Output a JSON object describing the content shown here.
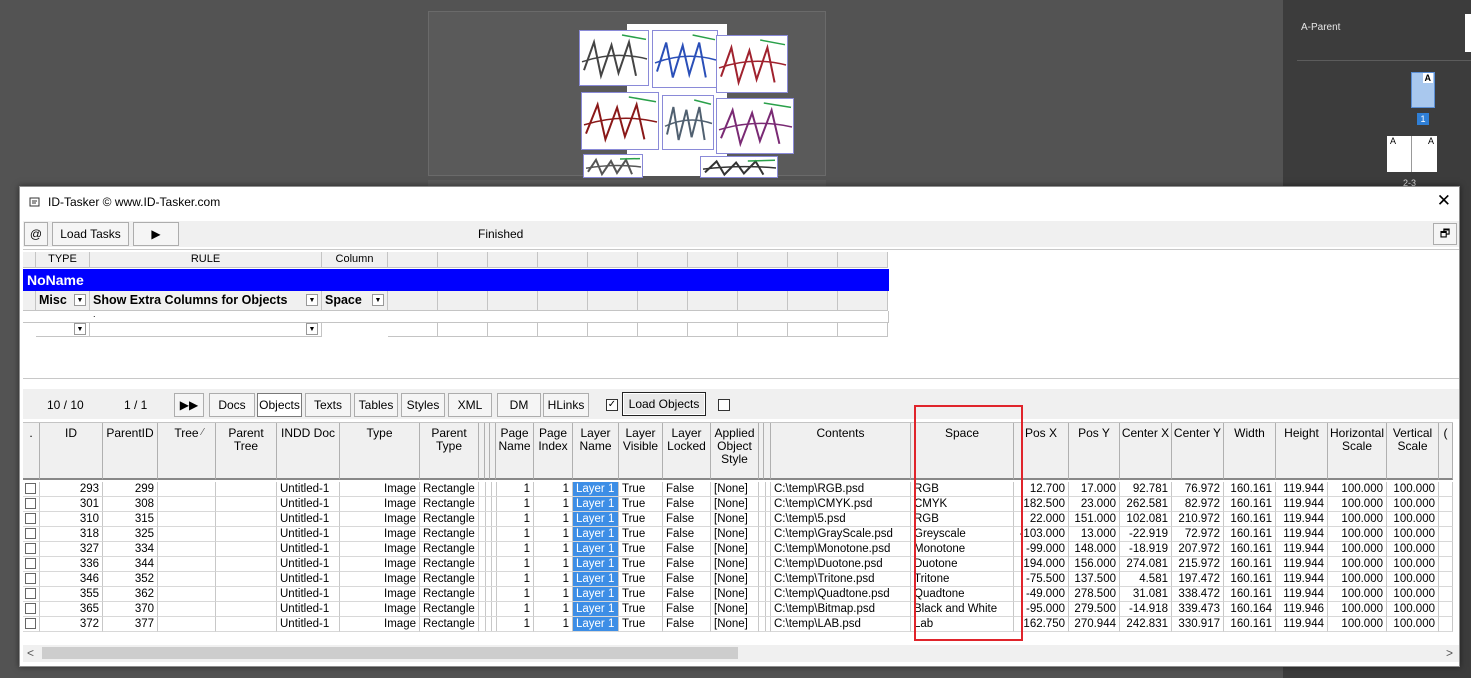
{
  "indesign": {
    "parent_label": "A-Parent",
    "page_marker": "A",
    "page_number": "1",
    "spread_left": "A",
    "spread_right": "A",
    "spread_number": "2-3"
  },
  "window": {
    "title": "ID-Tasker  © www.ID-Tasker.com",
    "close_glyph": "✕",
    "restore_glyph": "🗗"
  },
  "toolbar": {
    "at_label": "@",
    "load_tasks_label": "Load Tasks",
    "run_glyph": "▶",
    "status": "Finished"
  },
  "rule_grid": {
    "headers": [
      "TYPE",
      "RULE",
      "Column"
    ],
    "rule_name": "NoName",
    "misc": "Misc",
    "rule_text": "Show Extra Columns for Objects",
    "column_value": "Space",
    "dot": "."
  },
  "object_bar": {
    "count": "10 / 10",
    "page": "1 / 1",
    "next_glyph": "▶▶",
    "tabs": [
      "Docs",
      "Objects",
      "Texts",
      "Tables",
      "Styles",
      "XML",
      "DM",
      "HLinks"
    ],
    "active_tab": "Objects",
    "load_objects_label": "Load Objects",
    "check_on": "✓"
  },
  "grid": {
    "columns": [
      ".",
      "ID",
      "ParentID",
      "Tree",
      "Parent Tree",
      "INDD Doc",
      "Type",
      "Parent Type",
      "",
      "",
      "",
      "Page Name",
      "Page Index",
      "Layer Name",
      "Layer Visible",
      "Layer Locked",
      "Applied Object Style",
      "",
      "",
      "Contents",
      "Space",
      "Pos X",
      "Pos Y",
      "Center X",
      "Center Y",
      "Width",
      "Height",
      "Horizontal Scale",
      "Vertical Scale",
      "("
    ],
    "tree_sort_glyph": "⁄",
    "rows": [
      {
        "id": "293",
        "parent": "299",
        "doc": "Untitled-1",
        "type": "Image",
        "ptype": "Rectangle",
        "page": "1",
        "pidx": "1",
        "layer": "Layer 1",
        "vis": "True",
        "lock": "False",
        "style": "[None]",
        "contents": "C:\\temp\\RGB.psd",
        "space": "RGB",
        "posx": "12.700",
        "posy": "17.000",
        "cx": "92.781",
        "cy": "76.972",
        "w": "160.161",
        "h": "119.944",
        "hs": "100.000",
        "vs": "100.000"
      },
      {
        "id": "301",
        "parent": "308",
        "doc": "Untitled-1",
        "type": "Image",
        "ptype": "Rectangle",
        "page": "1",
        "pidx": "1",
        "layer": "Layer 1",
        "vis": "True",
        "lock": "False",
        "style": "[None]",
        "contents": "C:\\temp\\CMYK.psd",
        "space": "CMYK",
        "posx": "182.500",
        "posy": "23.000",
        "cx": "262.581",
        "cy": "82.972",
        "w": "160.161",
        "h": "119.944",
        "hs": "100.000",
        "vs": "100.000"
      },
      {
        "id": "310",
        "parent": "315",
        "doc": "Untitled-1",
        "type": "Image",
        "ptype": "Rectangle",
        "page": "1",
        "pidx": "1",
        "layer": "Layer 1",
        "vis": "True",
        "lock": "False",
        "style": "[None]",
        "contents": "C:\\temp\\5.psd",
        "space": "RGB",
        "posx": "22.000",
        "posy": "151.000",
        "cx": "102.081",
        "cy": "210.972",
        "w": "160.161",
        "h": "119.944",
        "hs": "100.000",
        "vs": "100.000"
      },
      {
        "id": "318",
        "parent": "325",
        "doc": "Untitled-1",
        "type": "Image",
        "ptype": "Rectangle",
        "page": "1",
        "pidx": "1",
        "layer": "Layer 1",
        "vis": "True",
        "lock": "False",
        "style": "[None]",
        "contents": "C:\\temp\\GrayScale.psd",
        "space": "Greyscale",
        "posx": "-103.000",
        "posy": "13.000",
        "cx": "-22.919",
        "cy": "72.972",
        "w": "160.161",
        "h": "119.944",
        "hs": "100.000",
        "vs": "100.000"
      },
      {
        "id": "327",
        "parent": "334",
        "doc": "Untitled-1",
        "type": "Image",
        "ptype": "Rectangle",
        "page": "1",
        "pidx": "1",
        "layer": "Layer 1",
        "vis": "True",
        "lock": "False",
        "style": "[None]",
        "contents": "C:\\temp\\Monotone.psd",
        "space": "Monotone",
        "posx": "-99.000",
        "posy": "148.000",
        "cx": "-18.919",
        "cy": "207.972",
        "w": "160.161",
        "h": "119.944",
        "hs": "100.000",
        "vs": "100.000"
      },
      {
        "id": "336",
        "parent": "344",
        "doc": "Untitled-1",
        "type": "Image",
        "ptype": "Rectangle",
        "page": "1",
        "pidx": "1",
        "layer": "Layer 1",
        "vis": "True",
        "lock": "False",
        "style": "[None]",
        "contents": "C:\\temp\\Duotone.psd",
        "space": "Duotone",
        "posx": "194.000",
        "posy": "156.000",
        "cx": "274.081",
        "cy": "215.972",
        "w": "160.161",
        "h": "119.944",
        "hs": "100.000",
        "vs": "100.000"
      },
      {
        "id": "346",
        "parent": "352",
        "doc": "Untitled-1",
        "type": "Image",
        "ptype": "Rectangle",
        "page": "1",
        "pidx": "1",
        "layer": "Layer 1",
        "vis": "True",
        "lock": "False",
        "style": "[None]",
        "contents": "C:\\temp\\Tritone.psd",
        "space": "Tritone",
        "posx": "-75.500",
        "posy": "137.500",
        "cx": "4.581",
        "cy": "197.472",
        "w": "160.161",
        "h": "119.944",
        "hs": "100.000",
        "vs": "100.000"
      },
      {
        "id": "355",
        "parent": "362",
        "doc": "Untitled-1",
        "type": "Image",
        "ptype": "Rectangle",
        "page": "1",
        "pidx": "1",
        "layer": "Layer 1",
        "vis": "True",
        "lock": "False",
        "style": "[None]",
        "contents": "C:\\temp\\Quadtone.psd",
        "space": "Quadtone",
        "posx": "-49.000",
        "posy": "278.500",
        "cx": "31.081",
        "cy": "338.472",
        "w": "160.161",
        "h": "119.944",
        "hs": "100.000",
        "vs": "100.000"
      },
      {
        "id": "365",
        "parent": "370",
        "doc": "Untitled-1",
        "type": "Image",
        "ptype": "Rectangle",
        "page": "1",
        "pidx": "1",
        "layer": "Layer 1",
        "vis": "True",
        "lock": "False",
        "style": "[None]",
        "contents": "C:\\temp\\Bitmap.psd",
        "space": "Black and White",
        "posx": "-95.000",
        "posy": "279.500",
        "cx": "-14.918",
        "cy": "339.473",
        "w": "160.164",
        "h": "119.946",
        "hs": "100.000",
        "vs": "100.000"
      },
      {
        "id": "372",
        "parent": "377",
        "doc": "Untitled-1",
        "type": "Image",
        "ptype": "Rectangle",
        "page": "1",
        "pidx": "1",
        "layer": "Layer 1",
        "vis": "True",
        "lock": "False",
        "style": "[None]",
        "contents": "C:\\temp\\LAB.psd",
        "space": "Lab",
        "posx": "162.750",
        "posy": "270.944",
        "cx": "242.831",
        "cy": "330.917",
        "w": "160.161",
        "h": "119.944",
        "hs": "100.000",
        "vs": "100.000"
      }
    ]
  },
  "scrollbar": {
    "left_glyph": "<",
    "right_glyph": ">"
  },
  "colors": {
    "rule_blue": "#0000ff",
    "layer_blue": "#3d8ee6",
    "highlight_red": "#e0242b"
  }
}
